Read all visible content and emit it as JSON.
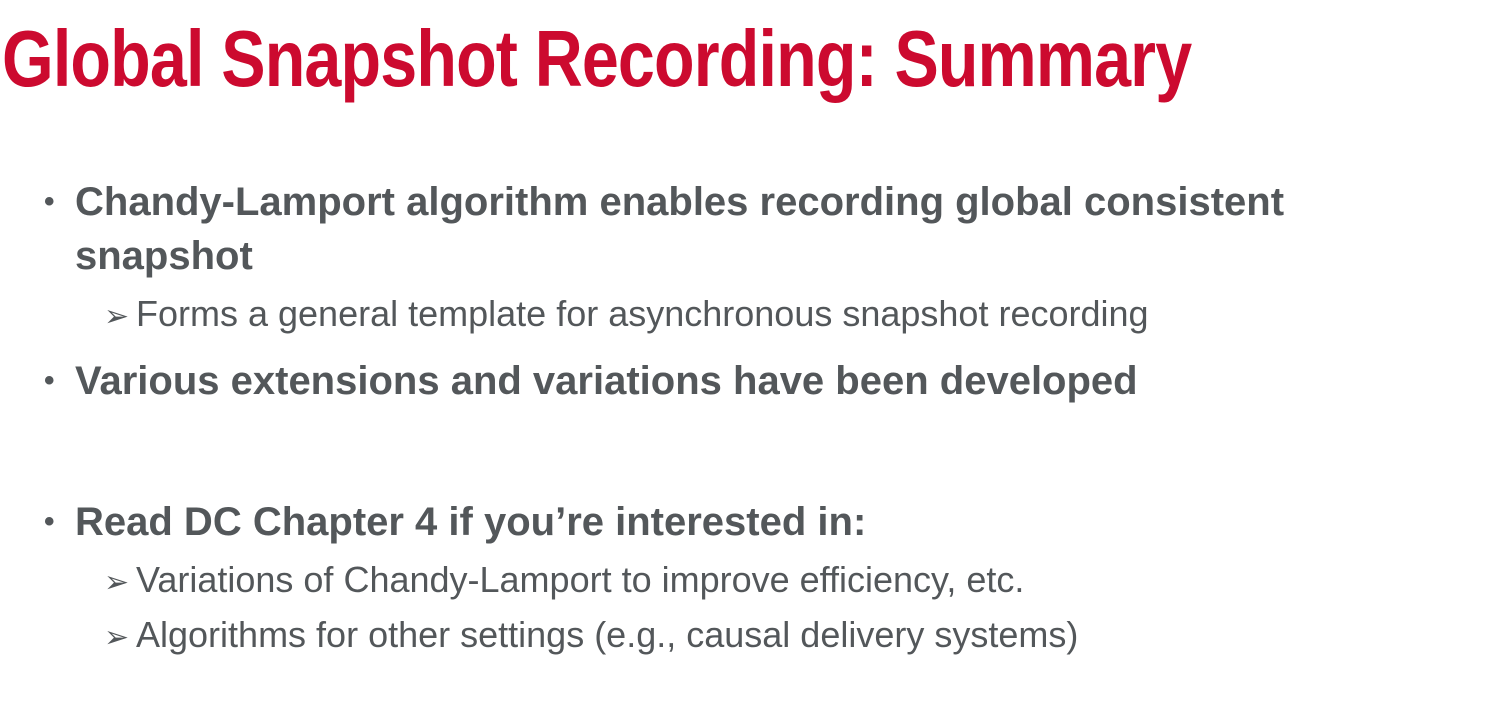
{
  "slide": {
    "title": "Global Snapshot Recording: Summary",
    "items": [
      {
        "bullet": "•",
        "text": "Chandy-Lamport algorithm enables recording global consistent snapshot",
        "subitems": [
          {
            "marker": "➢",
            "text": "Forms a general template for asynchronous snapshot recording"
          }
        ]
      },
      {
        "bullet": "•",
        "text": "Various extensions and variations have been developed",
        "subitems": []
      },
      {
        "bullet": "•",
        "text": "Read DC Chapter 4 if you’re interested in:",
        "subitems": [
          {
            "marker": "➢",
            "text": "Variations of Chandy-Lamport to improve efficiency, etc."
          },
          {
            "marker": "➢",
            "text": "Algorithms for other settings (e.g., causal delivery systems)"
          }
        ]
      }
    ]
  },
  "colors": {
    "title": "#cc0a2f",
    "body_text": "#53575a",
    "background": "#ffffff"
  }
}
